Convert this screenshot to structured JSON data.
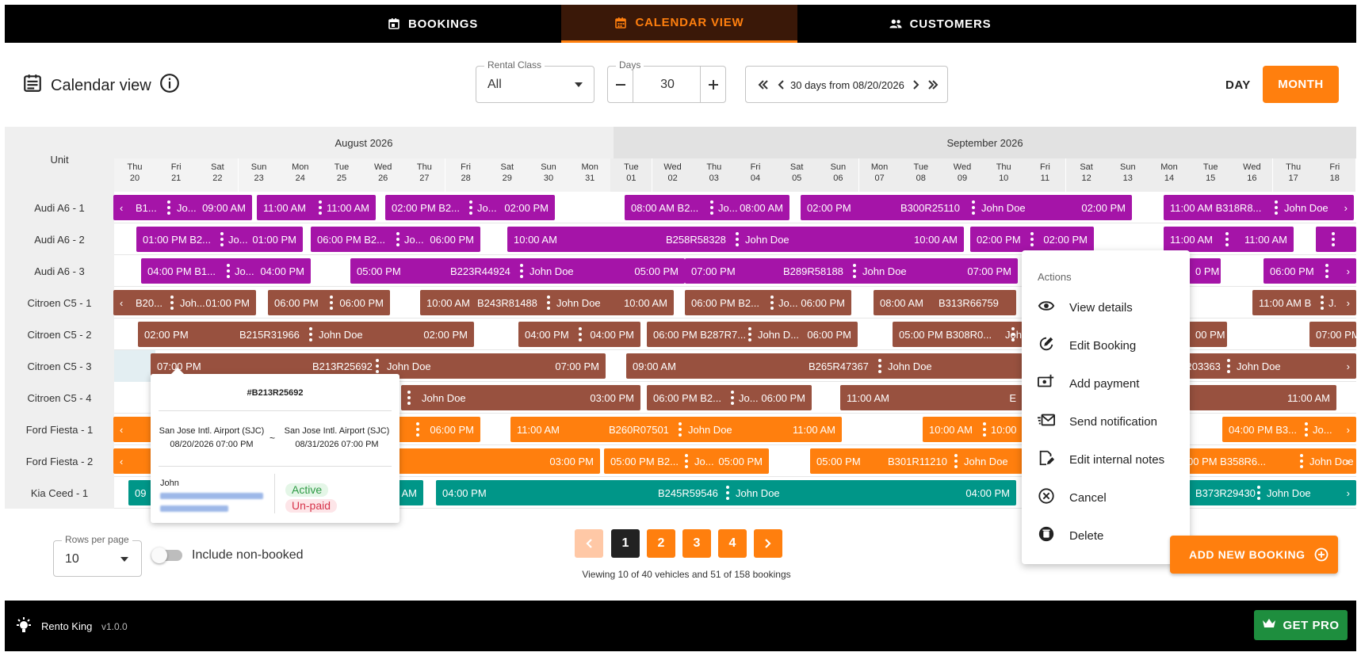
{
  "nav": {
    "tabs": [
      {
        "label": "BOOKINGS",
        "icon": "calendar-check-icon"
      },
      {
        "label": "CALENDAR VIEW",
        "icon": "calendar-icon"
      },
      {
        "label": "CUSTOMERS",
        "icon": "people-icon"
      }
    ]
  },
  "header": {
    "title": "Calendar view",
    "rental_class": {
      "label": "Rental Class",
      "value": "All"
    },
    "days": {
      "label": "Days",
      "value": "30"
    },
    "range_text": "30 days from 08/20/2026",
    "day_button": "DAY",
    "month_button": "MONTH"
  },
  "grid": {
    "unit_header": "Unit",
    "months": [
      "August 2026",
      "September 2026"
    ],
    "days": [
      {
        "w": "Thu",
        "d": "20"
      },
      {
        "w": "Fri",
        "d": "21"
      },
      {
        "w": "Sat",
        "d": "22"
      },
      {
        "w": "Sun",
        "d": "23"
      },
      {
        "w": "Mon",
        "d": "24"
      },
      {
        "w": "Tue",
        "d": "25"
      },
      {
        "w": "Wed",
        "d": "26"
      },
      {
        "w": "Thu",
        "d": "27"
      },
      {
        "w": "Fri",
        "d": "28"
      },
      {
        "w": "Sat",
        "d": "29"
      },
      {
        "w": "Sun",
        "d": "30"
      },
      {
        "w": "Mon",
        "d": "31"
      },
      {
        "w": "Tue",
        "d": "01"
      },
      {
        "w": "Wed",
        "d": "02"
      },
      {
        "w": "Thu",
        "d": "03"
      },
      {
        "w": "Fri",
        "d": "04"
      },
      {
        "w": "Sat",
        "d": "05"
      },
      {
        "w": "Sun",
        "d": "06"
      },
      {
        "w": "Mon",
        "d": "07"
      },
      {
        "w": "Tue",
        "d": "08"
      },
      {
        "w": "Wed",
        "d": "09"
      },
      {
        "w": "Thu",
        "d": "10"
      },
      {
        "w": "Fri",
        "d": "11"
      },
      {
        "w": "Sat",
        "d": "12"
      },
      {
        "w": "Sun",
        "d": "13"
      },
      {
        "w": "Mon",
        "d": "14"
      },
      {
        "w": "Tue",
        "d": "15"
      },
      {
        "w": "Wed",
        "d": "16"
      },
      {
        "w": "Thu",
        "d": "17"
      },
      {
        "w": "Fri",
        "d": "18"
      }
    ],
    "units": [
      "Audi A6 - 1",
      "Audi A6 - 2",
      "Audi A6 - 3",
      "Citroen C5 - 1",
      "Citroen C5 - 2",
      "Citroen C5 - 3",
      "Citroen C5 - 4",
      "Ford Fiesta - 1",
      "Ford Fiesta - 2",
      "Kia Ceed - 1"
    ],
    "bookings": {
      "r0b0": {
        "t1": "B1...",
        "t2": "Jo...",
        "t3": "09:00 AM"
      },
      "r0b1": {
        "t1": "11:00 AM",
        "t3": "11:00 AM"
      },
      "r0b2": {
        "t1": "02:00 PM B2...",
        "t2": "Jo...",
        "t3": "02:00 PM"
      },
      "r0b3": {
        "t1": "08:00 AM B2...",
        "t2": "Jo...",
        "t3": "08:00 AM"
      },
      "r0b4": {
        "t1": "02:00 PM",
        "code": "B300R25110",
        "t2": "John Doe",
        "t3": "02:00 PM"
      },
      "r0b5": {
        "t1": "11:00 AM B318R8...",
        "t2": "John Doe"
      },
      "r1b0": {
        "t1": "01:00 PM B2...",
        "t2": "Jo...",
        "t3": "01:00 PM"
      },
      "r1b1": {
        "t1": "06:00 PM B2...",
        "t2": "Jo...",
        "t3": "06:00 PM"
      },
      "r1b2": {
        "t1": "10:00 AM",
        "code": "B258R58328",
        "t2": "John Doe",
        "t3": "10:00 AM"
      },
      "r1b3": {
        "t1": "02:00 PM",
        "t3": "02:00 PM"
      },
      "r1b4": {
        "t1": "11:00 AM",
        "t3": "11:00 AM"
      },
      "r2b0": {
        "t1": "04:00 PM B1...",
        "t2": "Jo...",
        "t3": "04:00 PM"
      },
      "r2b1": {
        "t1": "05:00 PM",
        "code": "B223R44924",
        "t2": "John Doe",
        "t3": "05:00 PM"
      },
      "r2b2": {
        "t1": "07:00 PM",
        "code": "B289R58188",
        "t2": "John Doe",
        "t3": "07:00 PM"
      },
      "r2b3": {
        "t1": "0 PM"
      },
      "r2b4": {
        "t1": "06:00 PM"
      },
      "r3b0": {
        "t1": "B20...",
        "t2": "Joh...",
        "t3": "01:00 PM"
      },
      "r3b1": {
        "t1": "06:00 PM",
        "t3": "06:00 PM"
      },
      "r3b2": {
        "t1": "10:00 AM",
        "code": "B243R81488",
        "t2": "John Doe",
        "t3": "10:00 AM"
      },
      "r3b3": {
        "t1": "06:00 PM B2...",
        "t2": "Jo...",
        "t3": "06:00 PM"
      },
      "r3b4": {
        "t1": "08:00 AM",
        "code": "B313R66759"
      },
      "r3b5": {
        "t1": "11:00 AM B",
        "t3": "J."
      },
      "r4b0": {
        "t1": "02:00 PM",
        "code": "B215R31966",
        "t2": "John Doe",
        "t3": "02:00 PM"
      },
      "r4b1": {
        "t1": "04:00 PM",
        "t3": "04:00 PM"
      },
      "r4b2": {
        "t1": "06:00 PM B287R7...",
        "t2": "John D...",
        "t3": "06:00 PM"
      },
      "r4b3": {
        "t1": "05:00 PM B308R0...",
        "t2": "John"
      },
      "r4b4": {
        "t1": "00 PM"
      },
      "r4b5": {
        "t1": "07:00 PM"
      },
      "r5b0": {
        "t1": "07:00 PM",
        "code": "B213R25692",
        "t2": "John Doe",
        "t3": "07:00 PM"
      },
      "r5b1": {
        "t1": "09:00 AM",
        "code": "B265R47367",
        "t2": "John Doe"
      },
      "r5b2": {
        "t1": "B337R03363",
        "t2": "John Doe"
      },
      "r6b0": {
        "t2": "John Doe",
        "t3": "03:00 PM"
      },
      "r6b1": {
        "t1": "06:00 PM B2...",
        "t2": "Jo...",
        "t3": "06:00 PM"
      },
      "r6b2": {
        "t1": "11:00 AM",
        "t3": "E"
      },
      "r6b3": {
        "t3": "11:00 AM"
      },
      "r7b0": {
        "t3": "06:00 PM"
      },
      "r7b1": {
        "t1": "11:00 AM",
        "code": "B260R07501",
        "t2": "John Doe",
        "t3": "11:00 AM"
      },
      "r7b2": {
        "t1": "10:00 AM",
        "t3": "10:00"
      },
      "r7b3": {
        "t1": "04:00 PM B3...",
        "t2": "Jo..."
      },
      "r8b0": {
        "t3": "03:00 PM"
      },
      "r8b1": {
        "t1": "05:00 PM B2...",
        "t2": "Jo...",
        "t3": "05:00 PM"
      },
      "r8b2": {
        "t1": "05:00 PM",
        "code": "B301R11210",
        "t2": "John Doe"
      },
      "r8b3": {
        "t1": "00 PM B358R6...",
        "t2": "John Doe"
      },
      "r9b0": {
        "t1": "09"
      },
      "r9b1": {
        "t3": "AM"
      },
      "r9b2": {
        "t1": "04:00 PM",
        "code": "B245R59546",
        "t2": "John Doe",
        "t3": "04:00 PM"
      },
      "r9b3": {
        "t1": "B373R29430",
        "t2": "John Doe"
      }
    }
  },
  "popover": {
    "code": "#B213R25692",
    "from_location": "San Jose Intl. Airport (SJC)",
    "from_date": "08/20/2026 07:00 PM",
    "separator": "~",
    "to_location": "San Jose Intl. Airport (SJC)",
    "to_date": "08/31/2026 07:00 PM",
    "customer": "John",
    "status_active": "Active",
    "status_paid": "Un-paid"
  },
  "actions_menu": {
    "header": "Actions",
    "items": [
      {
        "label": "View details",
        "icon": "eye-icon"
      },
      {
        "label": "Edit Booking",
        "icon": "edit-icon"
      },
      {
        "label": "Add payment",
        "icon": "add-payment-icon"
      },
      {
        "label": "Send notification",
        "icon": "mail-icon"
      },
      {
        "label": "Edit internal notes",
        "icon": "note-edit-icon"
      },
      {
        "label": "Cancel",
        "icon": "cancel-icon"
      },
      {
        "label": "Delete",
        "icon": "delete-icon"
      }
    ]
  },
  "bottom": {
    "rows_per_page": {
      "label": "Rows per page",
      "value": "10"
    },
    "include_non_booked": "Include non-booked",
    "pages": [
      "1",
      "2",
      "3",
      "4"
    ],
    "viewing_text": "Viewing 10 of 40 vehicles and 51 of 158 bookings",
    "add_button": "ADD NEW BOOKING"
  },
  "footer": {
    "app_name": "Rento King",
    "version": "v1.0.0",
    "get_pro": "GET PRO"
  },
  "colors": {
    "accent": "#ff7f0e",
    "audi": "#a514a8",
    "citroen": "#98513f",
    "ford": "#ff7f0e",
    "kia": "#009688",
    "pro": "#1e8e3e",
    "nav_active_bg": "#3a1808"
  }
}
